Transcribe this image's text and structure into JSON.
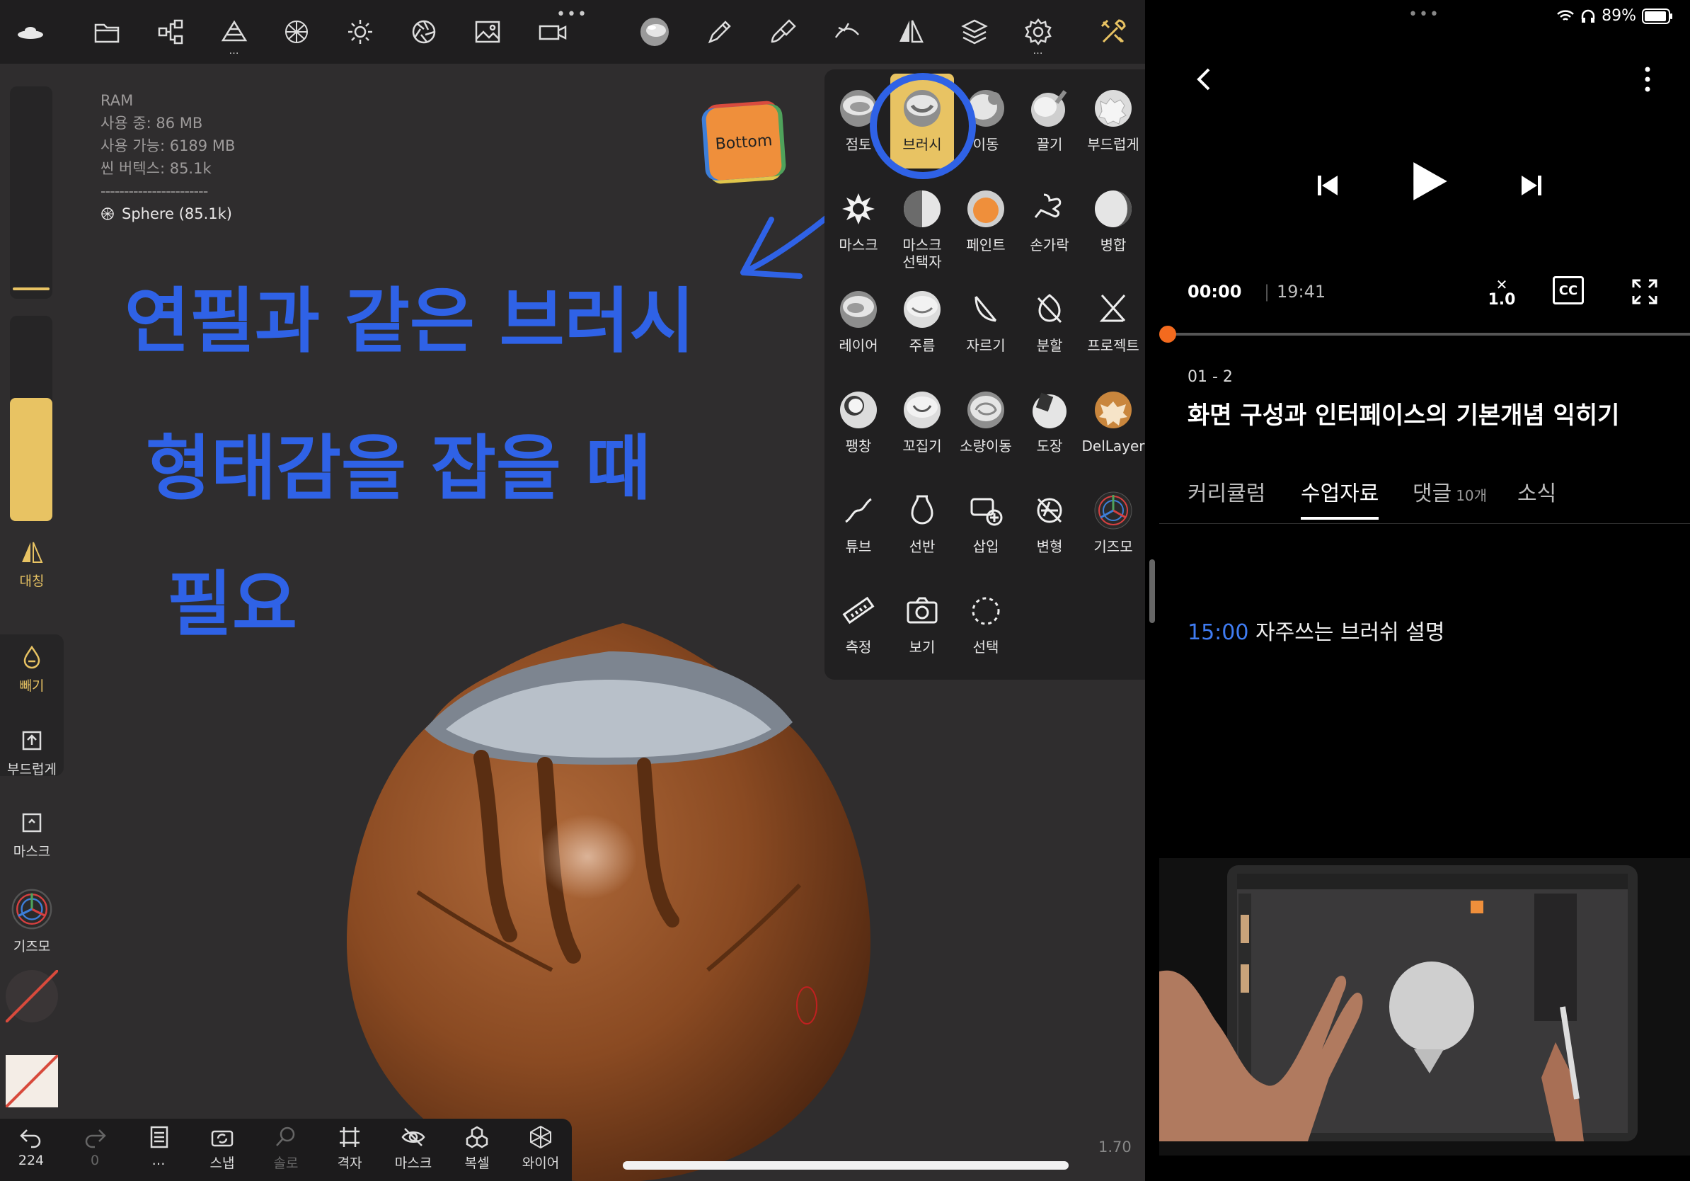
{
  "topbar": {
    "icons": [
      "logo-icon",
      "folder-icon",
      "scene-graph-icon",
      "topology-icon",
      "multires-icon",
      "lighting-icon",
      "material-icon",
      "background-icon",
      "video-record-icon",
      "matcap-sphere-icon",
      "brush-icon",
      "paint-brush-icon",
      "stroke-icon",
      "symmetry-icon",
      "layers-icon",
      "settings-icon",
      "tools-icon"
    ]
  },
  "info": {
    "ram_label": "RAM",
    "ram_used": "사용 중: 86 MB",
    "ram_free": "사용 가능: 6189 MB",
    "scene_vertices": "씬 버텍스: 85.1k",
    "divider": "-----------------------",
    "mesh": "Sphere (85.1k)"
  },
  "sticker": {
    "label": "Bottom"
  },
  "handwriting": {
    "line1": "연필과 같은 브러시",
    "line2": "형태감을 잡을 때",
    "line3": "필요"
  },
  "left_panel": {
    "symmetry": "대칭",
    "subtract": "빼기",
    "smooth": "부드럽게",
    "mask": "마스크",
    "gizmo": "기즈모"
  },
  "brush_menu": {
    "tools": [
      [
        "점토",
        "브러시",
        "이동",
        "끌기",
        "부드럽게"
      ],
      [
        "마스크",
        "마스크\n선택자",
        "페인트",
        "손가락",
        "병합"
      ],
      [
        "레이어",
        "주름",
        "자르기",
        "분할",
        "프로젝트"
      ],
      [
        "팽창",
        "꼬집기",
        "소량이동",
        "도장",
        "DelLayer"
      ],
      [
        "튜브",
        "선반",
        "삽입",
        "변형",
        "기즈모"
      ],
      [
        "측정",
        "보기",
        "선택"
      ]
    ]
  },
  "bottombar": {
    "undo_count": "224",
    "redo_count": "0",
    "items": [
      "…",
      "스냅",
      "솔로",
      "격자",
      "마스크",
      "복셀",
      "와이어"
    ]
  },
  "version": "1.70",
  "status": {
    "battery": "89%"
  },
  "player": {
    "current_time": "00:00",
    "separator": "|",
    "total_time": "19:41",
    "speed": "1.0",
    "cc": "CC"
  },
  "lesson": {
    "number": "01 - 2",
    "title": "화면 구성과 인터페이스의 기본개념 익히기"
  },
  "tabs": {
    "curriculum": "커리큘럼",
    "materials": "수업자료",
    "comments": "댓글",
    "comments_count": "10개",
    "news": "소식"
  },
  "material": {
    "timestamp": "15:00",
    "text": " 자주쓰는 브러쉬 설명"
  },
  "colors": {
    "accent_yellow": "#e8c363",
    "handwriting_blue": "#2f62e6",
    "progress_orange": "#f36a1e",
    "timestamp_blue": "#3f7cf2",
    "pot_brown": "#8a4a22"
  }
}
